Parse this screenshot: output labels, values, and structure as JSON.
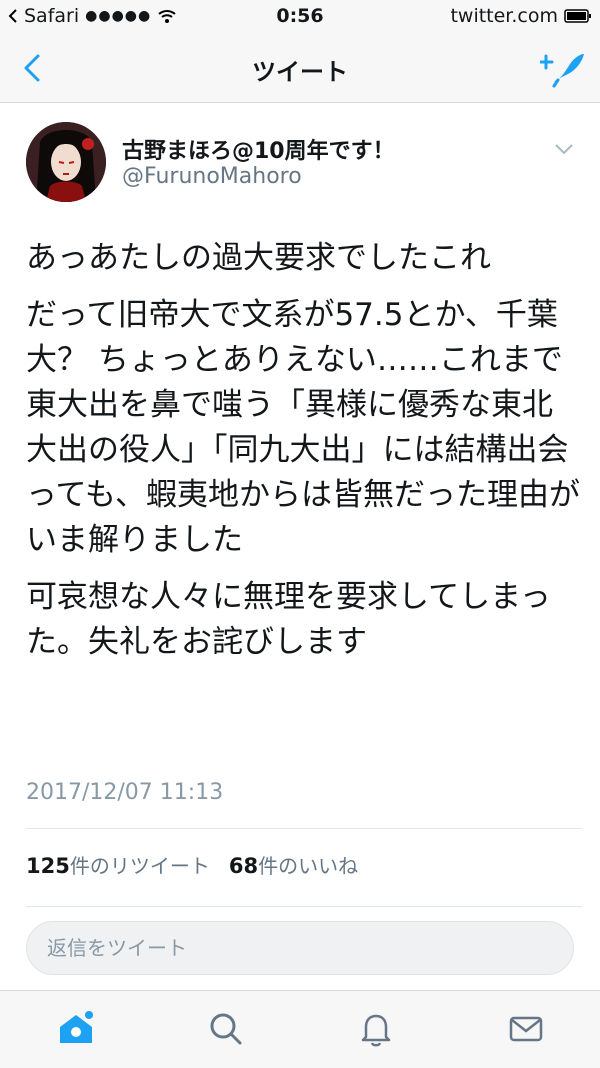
{
  "status_bar": {
    "carrier": "Safari",
    "signal": "●●●●●",
    "time": "0:56",
    "url": "twitter.com"
  },
  "nav": {
    "title": "ツイート"
  },
  "tweet": {
    "author_name": "古野まほろ@10周年です！",
    "handle": "@FurunoMahoro",
    "paragraphs": [
      "あっあたしの過大要求でしたこれ",
      "だって旧帝大で文系が57.5とか、千葉大？ ちょっとありえない……これまで東大出を鼻で嗤う「異様に優秀な東北大出の役人」「同九大出」には結構出会っても、蝦夷地からは皆無だった理由がいま解りました",
      "可哀想な人々に無理を要求してしまった。失礼をお詫びします"
    ],
    "timestamp": "2017/12/07 11:13",
    "retweet_count": "125",
    "retweet_label": "件のリツイート",
    "like_count": "68",
    "like_label": "件のいいね"
  },
  "reply": {
    "placeholder": "返信をツイート"
  },
  "colors": {
    "accent": "#1da1f2",
    "text": "#14171a",
    "muted": "#657786"
  },
  "icons": [
    "back-chevron-icon",
    "compose-tweet-icon",
    "chevron-down-icon",
    "home-icon",
    "search-icon",
    "notifications-icon",
    "messages-icon"
  ]
}
